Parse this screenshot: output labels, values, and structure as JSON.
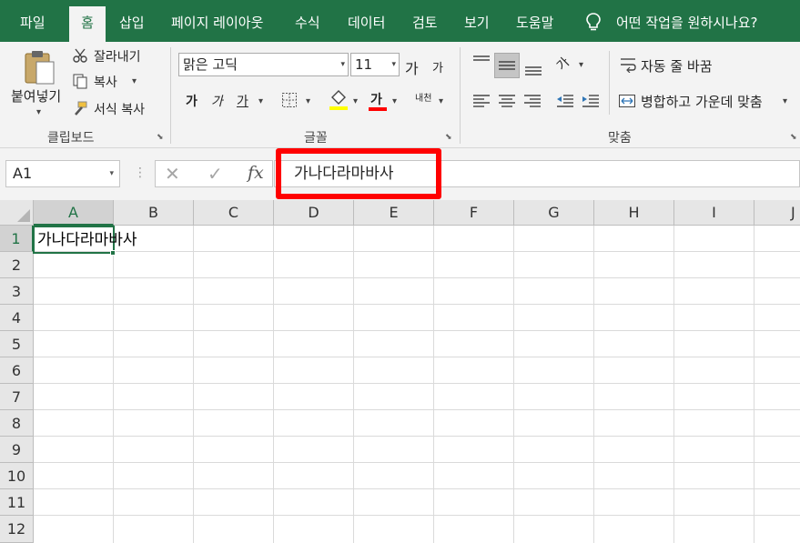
{
  "menu": {
    "tabs": [
      "파일",
      "홈",
      "삽입",
      "페이지 레이아웃",
      "수식",
      "데이터",
      "검토",
      "보기",
      "도움말"
    ],
    "active_tab": "홈",
    "tell_me": "어떤 작업을 원하시나요?"
  },
  "ribbon": {
    "clipboard": {
      "paste": "붙여넣기",
      "cut": "잘라내기",
      "copy": "복사",
      "format_painter": "서식 복사",
      "label": "클립보드"
    },
    "font": {
      "font_name": "맑은 고딕",
      "font_size": "11",
      "increase_size": "가",
      "decrease_size": "가",
      "bold": "가",
      "italic": "가",
      "underline": "가",
      "font_color": "가",
      "phonetic": "내천",
      "label": "글꼴",
      "fill_color": "#ffff00",
      "text_color": "#ff0000"
    },
    "alignment": {
      "wrap_text": "자동 줄 바꿈",
      "merge_center": "병합하고 가운데 맞춤",
      "orientation": "가",
      "label": "맞춤"
    }
  },
  "formula_bar": {
    "name_box": "A1",
    "fx": "fx",
    "cancel": "✕",
    "enter": "✓",
    "value": "가나다라마바사"
  },
  "sheet": {
    "columns": [
      "A",
      "B",
      "C",
      "D",
      "E",
      "F",
      "G",
      "H",
      "I",
      "J"
    ],
    "rows": [
      "1",
      "2",
      "3",
      "4",
      "5",
      "6",
      "7",
      "8",
      "9",
      "10",
      "11",
      "12"
    ],
    "selected_cell": "A1",
    "cell_A1": "가나다라마바사"
  },
  "colors": {
    "accent": "#217346",
    "highlight_box": "#ff0000"
  }
}
